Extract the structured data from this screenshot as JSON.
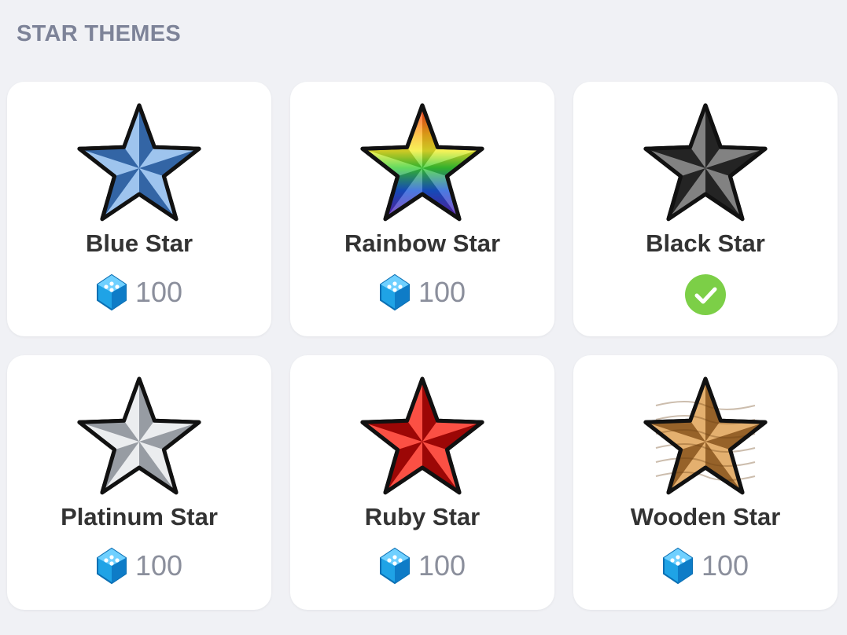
{
  "section": {
    "title": "STAR THEMES"
  },
  "currency_icon": "blue-gem-icon",
  "themes": [
    {
      "name": "Blue Star",
      "price": "100",
      "owned": false,
      "icon": "blue-star-icon",
      "colors": {
        "light": "#a9ccf2",
        "mid": "#5d93d6",
        "dark": "#2c5d9c"
      }
    },
    {
      "name": "Rainbow Star",
      "price": "100",
      "owned": false,
      "icon": "rainbow-star-icon",
      "colors": {
        "light": "#ffe04a",
        "mid": "#39c63a",
        "dark": "#3b2fbd"
      }
    },
    {
      "name": "Black Star",
      "price": null,
      "owned": true,
      "icon": "black-star-icon",
      "colors": {
        "light": "#8c8c8c",
        "mid": "#4a4a4a",
        "dark": "#1d1d1d"
      }
    },
    {
      "name": "Platinum Star",
      "price": "100",
      "owned": false,
      "icon": "platinum-star-icon",
      "colors": {
        "light": "#f2f3f5",
        "mid": "#c4c7cc",
        "dark": "#8f949b"
      }
    },
    {
      "name": "Ruby Star",
      "price": "100",
      "owned": false,
      "icon": "ruby-star-icon",
      "colors": {
        "light": "#ff5a4e",
        "mid": "#e0140e",
        "dark": "#8f0505"
      }
    },
    {
      "name": "Wooden Star",
      "price": "100",
      "owned": false,
      "icon": "wooden-star-icon",
      "colors": {
        "light": "#e9b677",
        "mid": "#c98c48",
        "dark": "#8d5a24"
      }
    }
  ],
  "colors": {
    "background": "#f0f1f5",
    "card": "#ffffff",
    "title": "#7d8398",
    "owned_check": "#7ccf47"
  }
}
